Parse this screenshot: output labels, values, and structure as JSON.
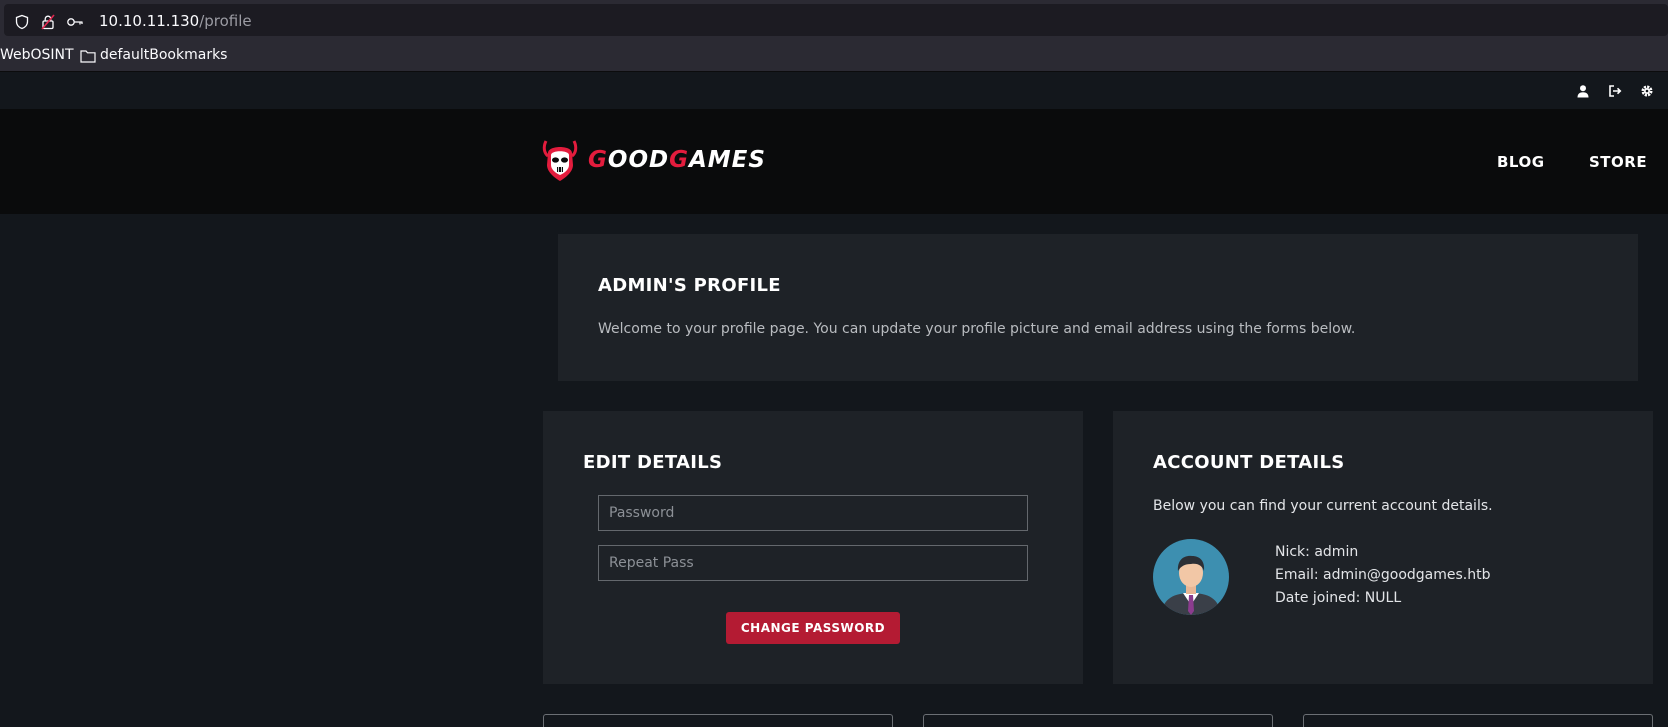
{
  "browser": {
    "url_host": "10.10.11.130",
    "url_path": "/profile",
    "bookmarks": [
      "WebOSINT",
      "defaultBookmarks"
    ]
  },
  "site": {
    "logo": {
      "part1_red": "G",
      "part1_rest": "OOD",
      "part2_red": "G",
      "part2_rest": "AMES"
    },
    "nav": [
      "BLOG",
      "STORE"
    ],
    "top_icons": [
      "user-icon",
      "logout-icon",
      "settings-icon"
    ]
  },
  "profile": {
    "title": "ADMIN'S PROFILE",
    "welcome": "Welcome to your profile page. You can update your profile picture and email address using the forms below."
  },
  "edit_details": {
    "title": "EDIT DETAILS",
    "password_placeholder": "Password",
    "repeat_placeholder": "Repeat Pass",
    "button": "CHANGE PASSWORD"
  },
  "account_details": {
    "title": "ACCOUNT DETAILS",
    "intro": "Below you can find your current account details.",
    "nick": "Nick: admin",
    "email": "Email: admin@goodgames.htb",
    "date_joined": "Date joined: NULL"
  },
  "colors": {
    "accent": "#b41b33",
    "logo_red": "#e31c3d",
    "panel": "#1e2227",
    "background": "#13171c"
  }
}
